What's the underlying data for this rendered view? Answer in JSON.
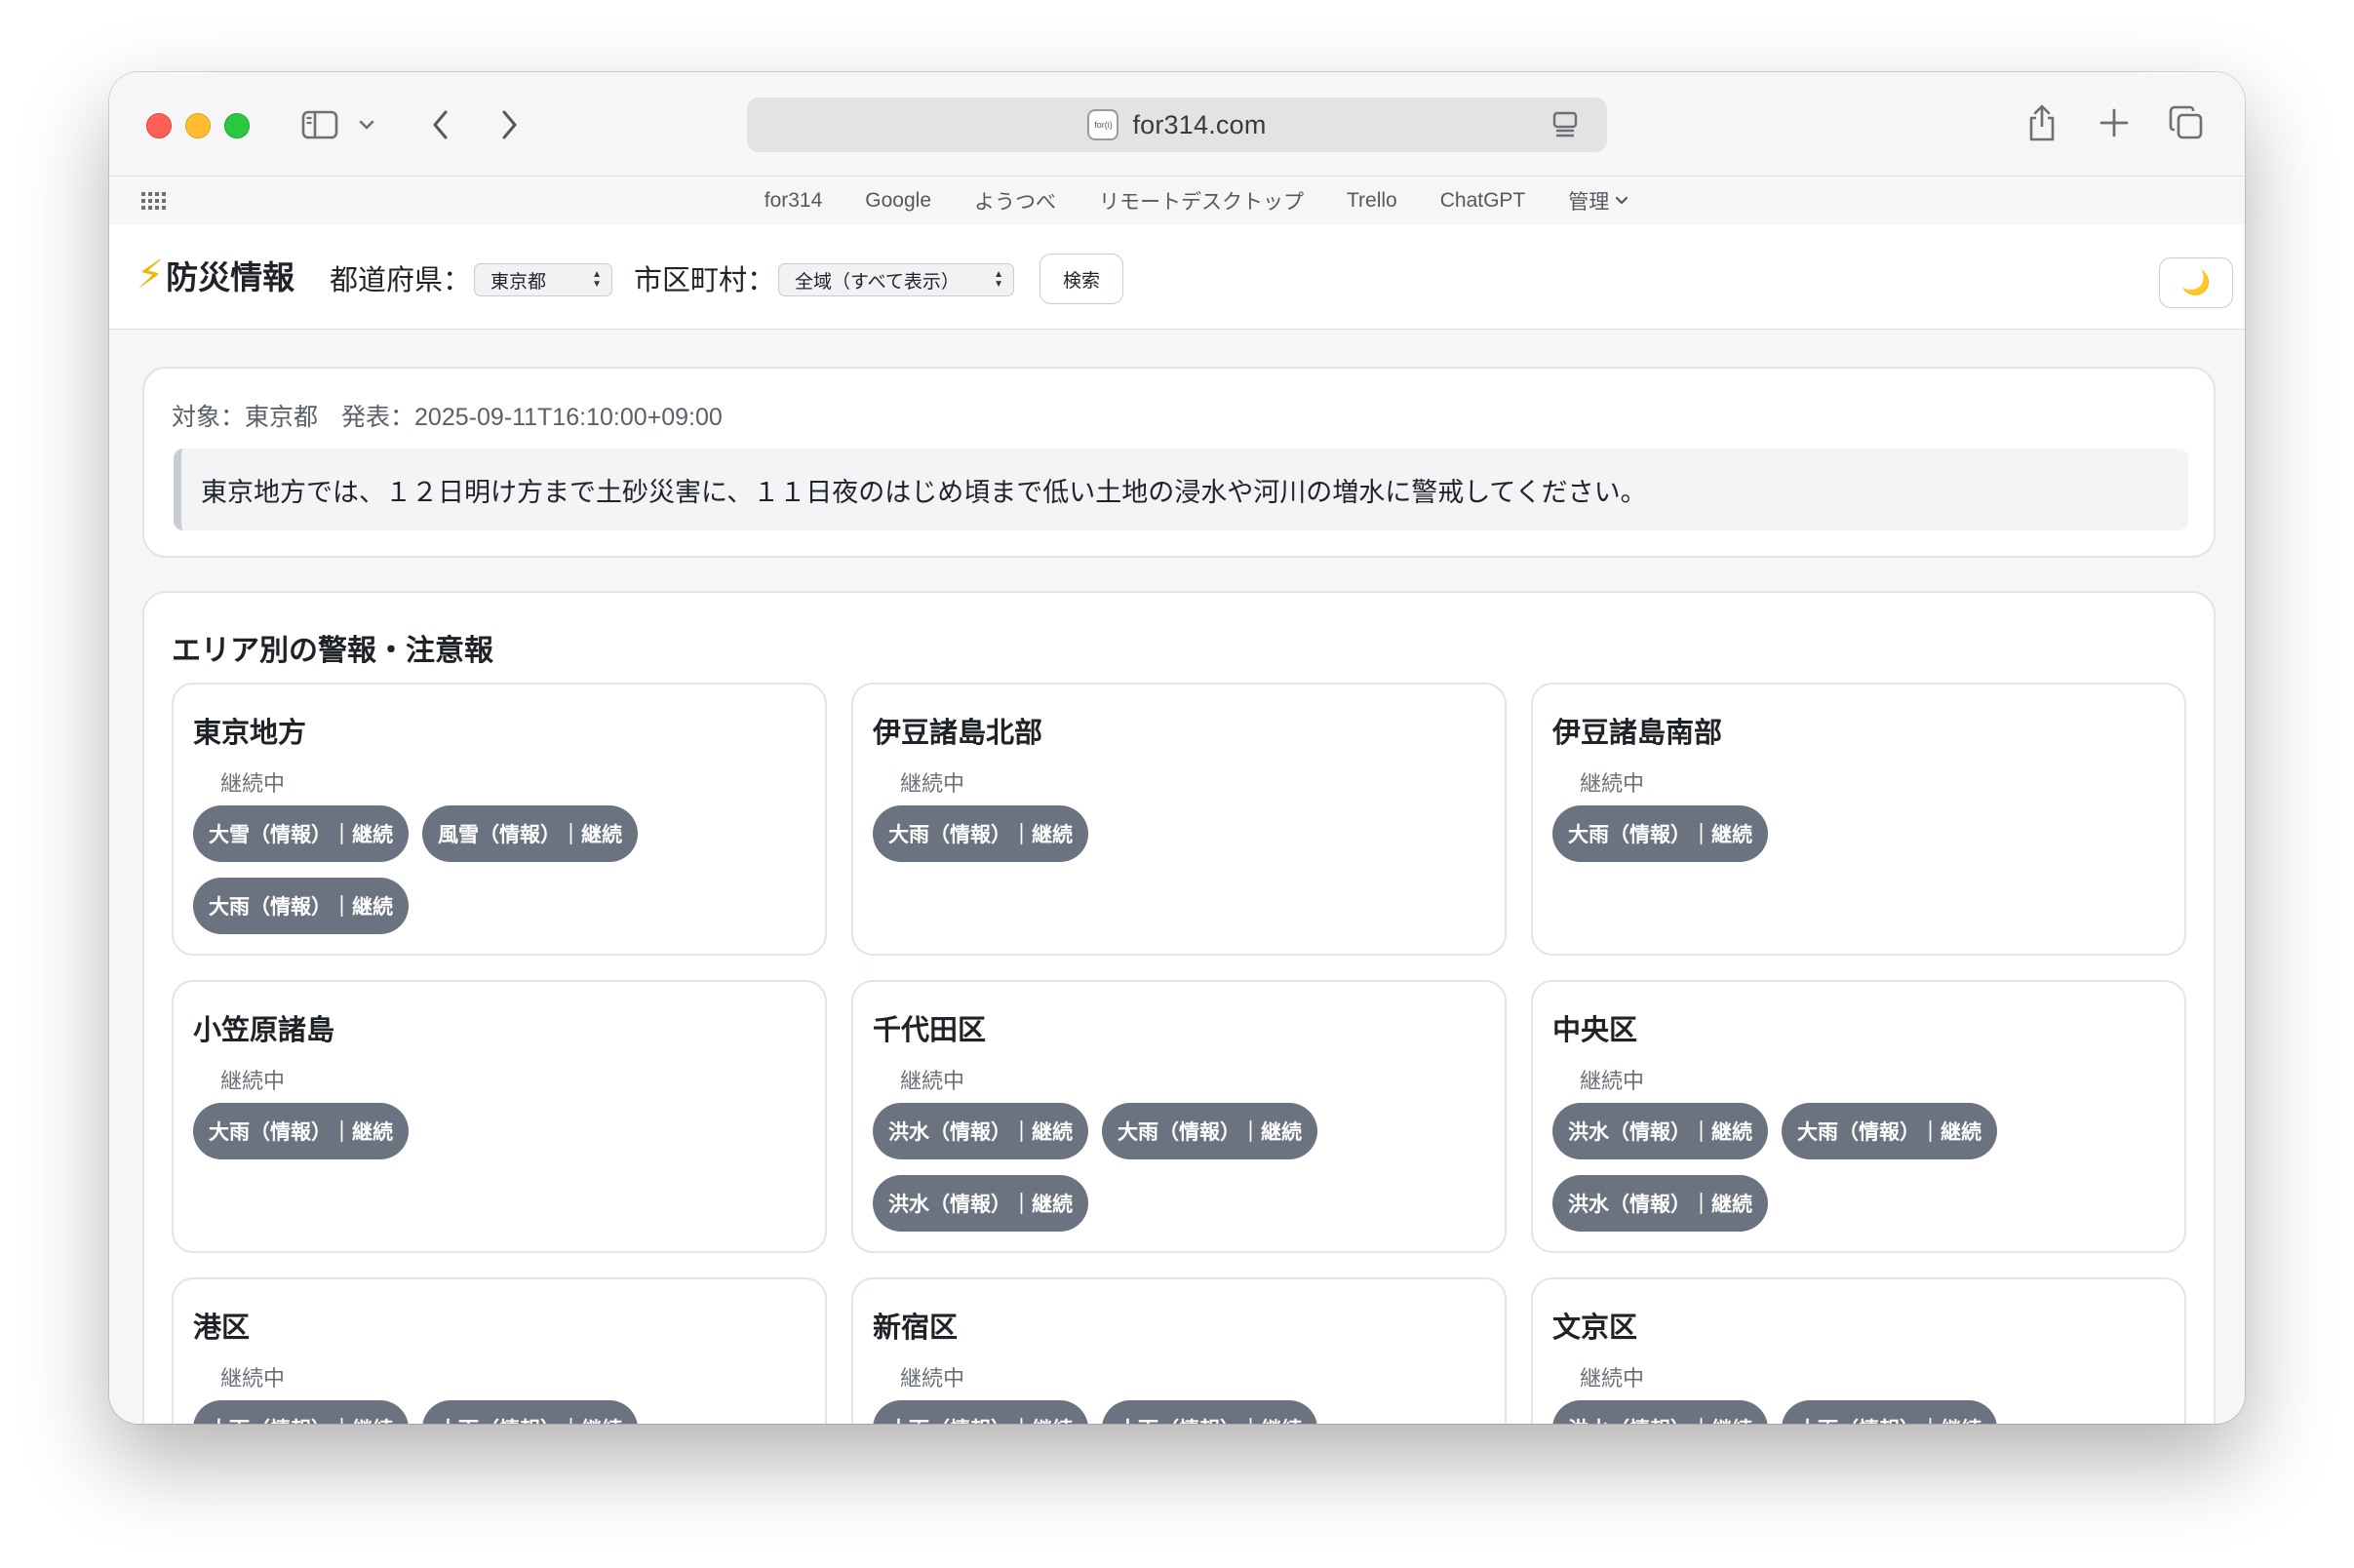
{
  "browser": {
    "url": "for314.com",
    "favicon_text": "for(i)",
    "favorites": [
      "for314",
      "Google",
      "ようつべ",
      "リモートデスクトップ",
      "Trello",
      "ChatGPT",
      "管理"
    ]
  },
  "header": {
    "title": "防災情報",
    "pref_label": "都道府県：",
    "pref_value": "東京都",
    "city_label": "市区町村：",
    "city_value": "全域（すべて表示）",
    "search_label": "検索",
    "theme_icon": "🌙"
  },
  "summary": {
    "target": "対象：東京都",
    "issued": "発表：2025-09-11T16:10:00+09:00",
    "headline": "東京地方では、１２日明け方まで土砂災害に、１１日夜のはじめ頃まで低い土地の浸水や河川の増水に警戒してください。"
  },
  "areas_title": "エリア別の警報・注意報",
  "areas": [
    {
      "name": "東京地方",
      "status": "継続中",
      "tags": [
        "大雪（情報）｜継続",
        "風雪（情報）｜継続",
        "大雨（情報）｜継続"
      ]
    },
    {
      "name": "伊豆諸島北部",
      "status": "継続中",
      "tags": [
        "大雨（情報）｜継続"
      ]
    },
    {
      "name": "伊豆諸島南部",
      "status": "継続中",
      "tags": [
        "大雨（情報）｜継続"
      ]
    },
    {
      "name": "小笠原諸島",
      "status": "継続中",
      "tags": [
        "大雨（情報）｜継続"
      ]
    },
    {
      "name": "千代田区",
      "status": "継続中",
      "tags": [
        "洪水（情報）｜継続",
        "大雨（情報）｜継続",
        "洪水（情報）｜継続"
      ]
    },
    {
      "name": "中央区",
      "status": "継続中",
      "tags": [
        "洪水（情報）｜継続",
        "大雨（情報）｜継続",
        "洪水（情報）｜継続"
      ]
    },
    {
      "name": "港区",
      "status": "継続中",
      "tags": [
        "大雨（情報）｜継続",
        "大雨（情報）｜継続"
      ]
    },
    {
      "name": "新宿区",
      "status": "継続中",
      "tags": [
        "大雨（情報）｜継続",
        "大雨（情報）｜継続"
      ]
    },
    {
      "name": "文京区",
      "status": "継続中",
      "tags": [
        "洪水（情報）｜継続",
        "大雨（情報）｜継続"
      ]
    }
  ]
}
